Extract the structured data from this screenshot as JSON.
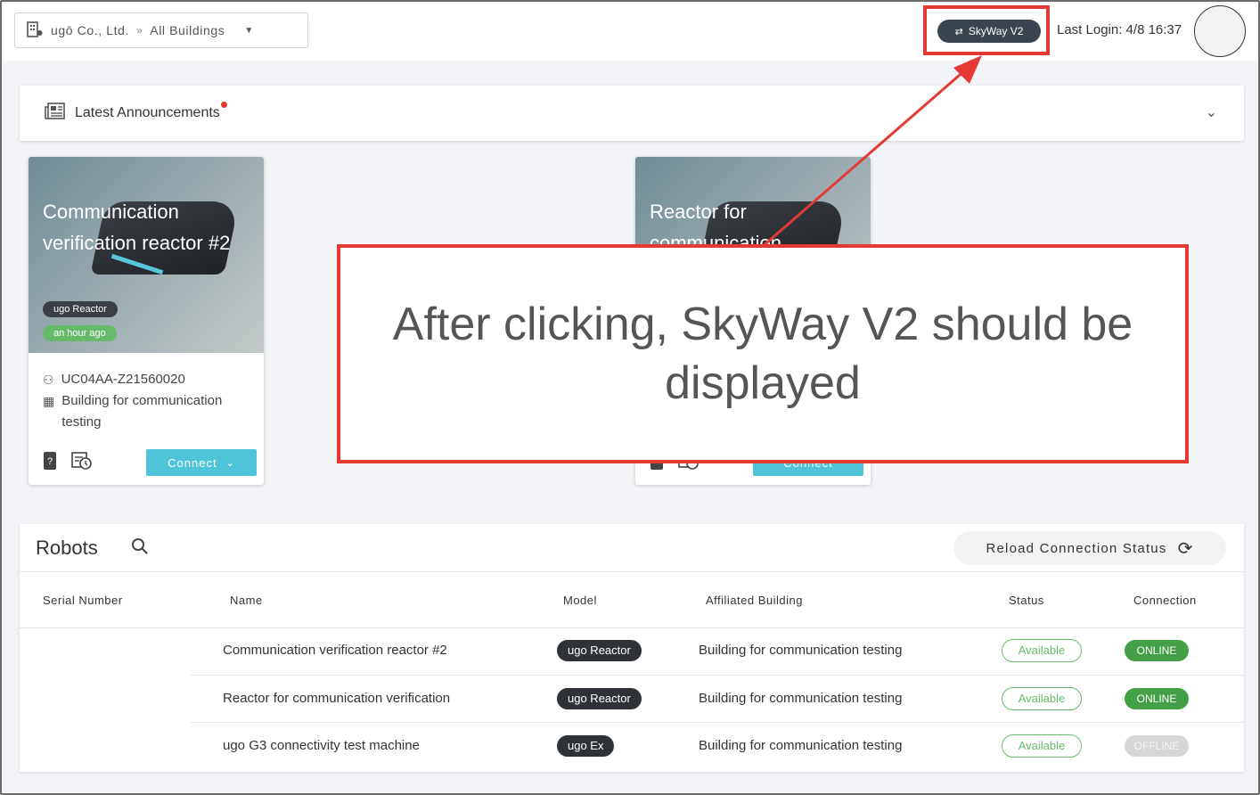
{
  "topbar": {
    "company": "ugō Co., Ltd.",
    "separator": "»",
    "building": "All Buildings",
    "skyway_label": "SkyWay V2",
    "last_login": "Last Login: 4/8 16:37"
  },
  "announcements": {
    "label": "Latest Announcements"
  },
  "cards": [
    {
      "title": "Communication verification reactor #2",
      "model": "ugo Reactor",
      "time": "an hour ago",
      "serial": "UC04AA-Z21560020",
      "building": "Building for communication testing",
      "connect_label": "Connect"
    },
    {
      "title": "Reactor for communication",
      "connect_label": "Connect"
    }
  ],
  "robots": {
    "title": "Robots",
    "reload_label": "Reload Connection Status",
    "columns": [
      "Serial Number",
      "Name",
      "Model",
      "Affiliated Building",
      "Status",
      "Connection"
    ],
    "rows": [
      {
        "name": "Communication verification reactor #2",
        "model": "ugo Reactor",
        "building": "Building for communication testing",
        "status": "Available",
        "connection": "ONLINE"
      },
      {
        "name": "Reactor for communication verification",
        "model": "ugo Reactor",
        "building": "Building for communication testing",
        "status": "Available",
        "connection": "ONLINE"
      },
      {
        "name": "ugo G3 connectivity test machine",
        "model": "ugo Ex",
        "building": "Building for communication testing",
        "status": "Available",
        "connection": "OFFLINE"
      }
    ]
  },
  "annotation": {
    "text": "After clicking, SkyWay V2 should be displayed"
  },
  "colors": {
    "accent": "#4fc3d9",
    "online": "#43a047",
    "available": "#66bb6a",
    "annotation": "#e53935"
  }
}
